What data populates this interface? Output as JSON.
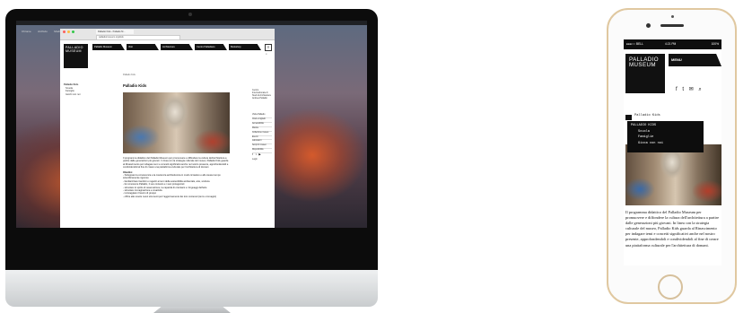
{
  "desktop": {
    "menubar": [
      "Chrome",
      "Archivio",
      "Modifica",
      "Visualizza",
      "Cronologia",
      "Preferiti",
      "Persone",
      "Finestra",
      "Aiuto"
    ],
    "browser": {
      "tab_title": "Palladio Kids - Palladio M...",
      "url": "palladiomuseum.org/kids"
    },
    "logo_lines": [
      "PALLADIO",
      "MUSEUM"
    ],
    "nav_tabs": [
      "Palladio Museum",
      "Visit",
      "Architecture",
      "Centro Palladiano",
      "Bookshop"
    ],
    "site_icons": [
      "☰",
      "⌕"
    ],
    "side_nav": {
      "heading": "Palladio Kids",
      "items": [
        "Scuola",
        "Famiglie",
        "Giochi con noi"
      ]
    },
    "breadcrumb": "Palladio Kids",
    "page_title": "Palladio Kids",
    "intro": "Il programma didattico del Palladio Museum per promuovere e diffondere la cultura dell'architettura a partire dalle generazioni più giovani. In linea con la strategia culturale del museo, Palladio Kids guarda al Rinascimento per indagare temi e concetti significativi anche nel nostro presente, approfondendoli e condividendoli al fine di creare una piattaforma culturale per l'architettura di domani.",
    "objectives_heading": "Obiettivi",
    "objectives": [
      "- Sviluppare la conoscenza e la coscienza architettonica in modo ricreativo e allo stesso tempo scientificamente rigoroso",
      "- familiarizzare bambini e ragazzi ai temi della sostenibilità ambientale, arte, scultura",
      "- far conoscere Palladio, il suo contesto e i suoi protagonisti",
      "- stimolare lo spirito di osservazione, la capacità di orientarsi e i linguaggi dell'arte",
      "- stimolare immaginazione e creatività",
      "- incoraggiare il lavoro di gruppo",
      "- offrire alle scuole nuovi strumenti per l'aggiornamento dei loro contenuti (temi e immagini)"
    ],
    "right_info": "Centro Internazionale di Studi di Architettura Andrea Palladio",
    "right_links": [
      "Visita Palladio",
      "Orari e biglietti",
      "Accessibilità",
      "Mostre",
      "Collezione museo",
      "Eventi",
      "Laboratori",
      "Scopri il museo",
      "Disponibilità"
    ],
    "social_icons": [
      "f",
      "t",
      "▶"
    ],
    "login_label": "Login"
  },
  "mobile": {
    "status": {
      "carrier": "●●●○○ BELL",
      "time": "4:21 PM",
      "battery": "100%"
    },
    "logo_lines": [
      "PALLADIO",
      "MUSEUM"
    ],
    "menu_label": "MENU",
    "social_icons": [
      "f",
      "t",
      "✉",
      "⌕"
    ],
    "kids_header": "Palladio Kids",
    "dropdown": {
      "heading": "PALLADIO KIDS",
      "items": [
        "Scuola",
        "Famiglie",
        "Gioca con noi"
      ]
    },
    "intro": "Il programma didattico del Palladio Museum per promuovere e diffondere la cultura dell'architettura a partire dalle generazioni più giovani. In linea con la strategia culturale del museo, Palladio Kids guarda al Rinascimento per indagare temi e concetti significativi anche nel nostro presente, approfondendoli e condividendoli al fine di creare una piattaforma culturale per l'architettura di domani."
  }
}
